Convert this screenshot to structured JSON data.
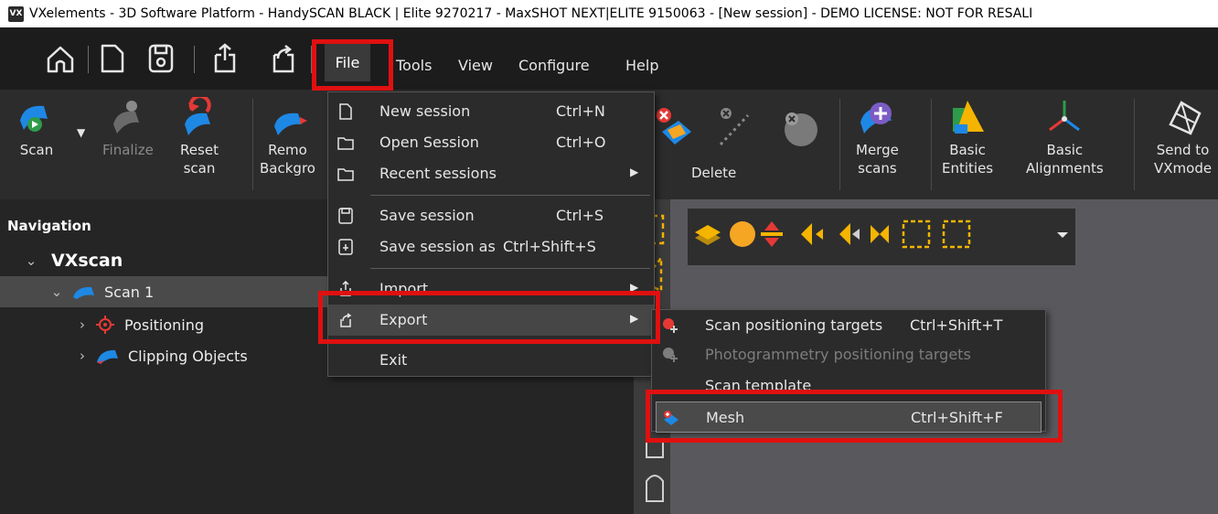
{
  "window": {
    "title": "VXelements - 3D Software Platform - HandySCAN BLACK | Elite 9270217 - MaxSHOT NEXT|ELITE 9150063 - [New session] - DEMO LICENSE: NOT FOR RESALI",
    "logo_text": "VX"
  },
  "menubar": {
    "file": "File",
    "tools": "Tools",
    "view": "View",
    "configure": "Configure",
    "help": "Help"
  },
  "ribbon": {
    "scan": "Scan",
    "finalize": "Finalize",
    "reset_scan": [
      "Reset",
      "scan"
    ],
    "remove_background": [
      "Remo",
      "Backgro"
    ],
    "delete": "Delete",
    "merge_scans": [
      "Merge",
      "scans"
    ],
    "basic_entities": [
      "Basic",
      "Entities"
    ],
    "basic_alignments": [
      "Basic",
      "Alignments"
    ],
    "send_to": [
      "Send to",
      "VXmode"
    ]
  },
  "navigation": {
    "title": "Navigation",
    "root": "VXscan",
    "scan": "Scan 1",
    "positioning": "Positioning",
    "clipping": "Clipping Objects"
  },
  "file_menu": {
    "new_session": {
      "label": "New session",
      "shortcut": "Ctrl+N"
    },
    "open_session": {
      "label": "Open Session",
      "shortcut": "Ctrl+O"
    },
    "recent_sessions": {
      "label": "Recent sessions"
    },
    "save_session": {
      "label": "Save session",
      "shortcut": "Ctrl+S"
    },
    "save_session_as": {
      "label": "Save session as",
      "shortcut": "Ctrl+Shift+S"
    },
    "import": {
      "label": "Import"
    },
    "export": {
      "label": "Export"
    },
    "exit": {
      "label": "Exit"
    }
  },
  "export_menu": {
    "scan_positioning_targets": {
      "label": "Scan positioning targets",
      "shortcut": "Ctrl+Shift+T"
    },
    "photogrammetry_positioning_targets": {
      "label": "Photogrammetry positioning targets"
    },
    "scan_template": {
      "label": "Scan template"
    },
    "mesh": {
      "label": "Mesh",
      "shortcut": "Ctrl+Shift+F"
    }
  },
  "colors": {
    "accent_blue": "#1e88e5",
    "highlight_red": "#e01010",
    "dark_bg": "#1c1c1c",
    "ribbon_bg": "#2c2c2c"
  }
}
